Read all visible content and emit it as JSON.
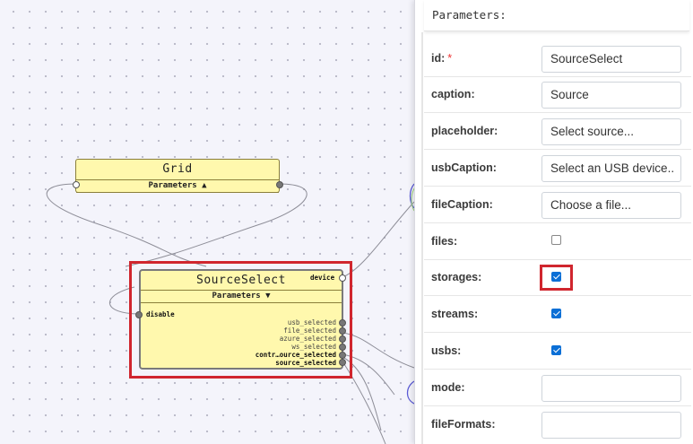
{
  "colors": {
    "accent": "#0b6fd6",
    "highlight": "#d0262e",
    "node_fill": "#fff8ad"
  },
  "canvas": {
    "grid_node": {
      "title": "Grid",
      "params_label": "Parameters ▲"
    },
    "source_node": {
      "title": "SourceSelect",
      "params_label": "Parameters ▼",
      "ports": {
        "device": "device",
        "disable": "disable",
        "usb_selected": "usb_selected",
        "file_selected": "file_selected",
        "azure_selected": "azure_selected",
        "ws_selected": "ws_selected",
        "contr_source_selected": "contr…ource_selected",
        "source_selected": "source_selected"
      }
    }
  },
  "panel": {
    "title": "Parameters:",
    "rows": [
      {
        "label": "id:",
        "required": "*",
        "value": "SourceSelect"
      },
      {
        "label": "caption:",
        "value": "Source"
      },
      {
        "label": "placeholder:",
        "value": "Select source..."
      },
      {
        "label": "usbCaption:",
        "value": "Select an USB device.."
      },
      {
        "label": "fileCaption:",
        "value": "Choose a file..."
      },
      {
        "label": "files:",
        "checked": false
      },
      {
        "label": "storages:",
        "checked": true
      },
      {
        "label": "streams:",
        "checked": true
      },
      {
        "label": "usbs:",
        "checked": true
      },
      {
        "label": "mode:",
        "value": ""
      },
      {
        "label": "fileFormats:",
        "value": ""
      }
    ]
  }
}
